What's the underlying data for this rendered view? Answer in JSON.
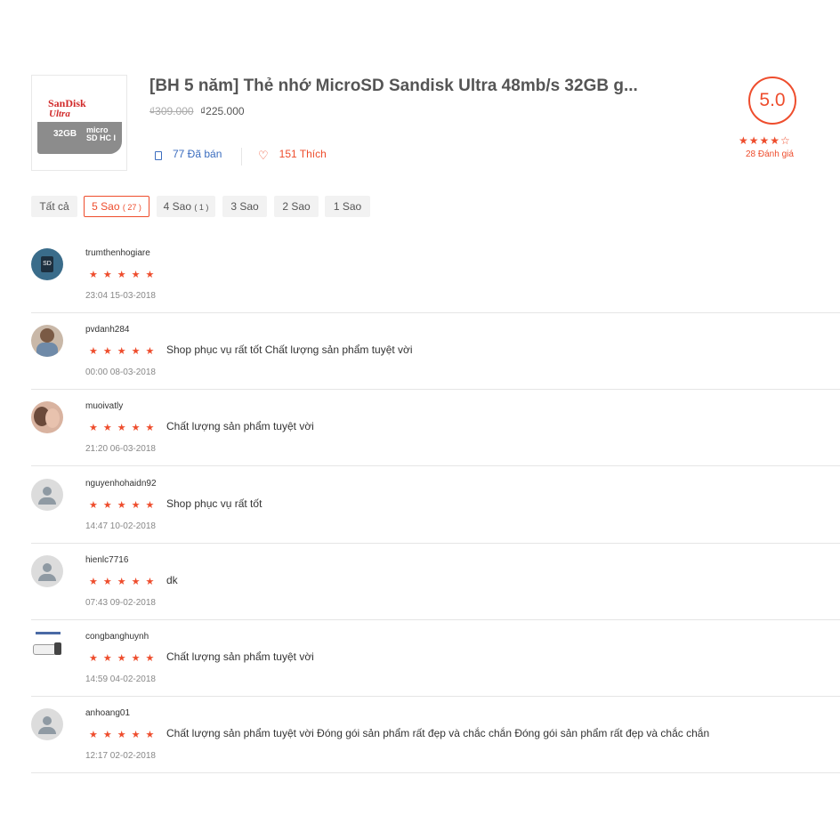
{
  "product": {
    "title": "[BH 5 năm] Thẻ nhớ MicroSD Sandisk Ultra 48mb/s 32GB g...",
    "old_price": "₫309.000",
    "new_price": "₫225.000",
    "sold": "77 Đã bán",
    "likes": "151 Thích",
    "image": {
      "brand": "SanDisk",
      "line": "Ultra",
      "capacity": "32GB",
      "logo_top": "micro",
      "logo_bottom": "SD HC I"
    }
  },
  "rating": {
    "score": "5.0",
    "stars": "★★★★☆",
    "count_label": "28 Đánh giá"
  },
  "filters": [
    {
      "label": "Tất cả",
      "count": ""
    },
    {
      "label": "5 Sao",
      "count": "( 27 )"
    },
    {
      "label": "4 Sao",
      "count": "( 1 )"
    },
    {
      "label": "3 Sao",
      "count": ""
    },
    {
      "label": "2 Sao",
      "count": ""
    },
    {
      "label": "1 Sao",
      "count": ""
    }
  ],
  "review_stars": "★★★★★",
  "reviews": [
    {
      "user": "trumthenhogiare",
      "comment": "",
      "time": "23:04 15-03-2018",
      "avatar": "sd-card-avatar",
      "chip": "SD"
    },
    {
      "user": "pvdanh284",
      "comment": "Shop phục vụ rất tốt Chất lượng sản phẩm tuyệt vời",
      "time": "00:00 08-03-2018",
      "avatar": "photo-avatar"
    },
    {
      "user": "muoivatly",
      "comment": "Chất lượng sản phẩm tuyệt vời",
      "time": "21:20 06-03-2018",
      "avatar": "photo-avatar"
    },
    {
      "user": "nguyenhohaidn92",
      "comment": "Shop phục vụ rất tốt",
      "time": "14:47 10-02-2018",
      "avatar": "default-user-avatar"
    },
    {
      "user": "hienlc7716",
      "comment": "dk",
      "time": "07:43 09-02-2018",
      "avatar": "default-user-avatar"
    },
    {
      "user": "congbanghuynh",
      "comment": "Chất lượng sản phẩm tuyệt vời",
      "time": "14:59 04-02-2018",
      "avatar": "camera-avatar"
    },
    {
      "user": "anhoang01",
      "comment": "Chất lượng sản phẩm tuyệt vời Đóng gói sản phẩm rất đẹp và chắc chắn Đóng gói sản phẩm rất đẹp và chắc chắn",
      "time": "12:17 02-02-2018",
      "avatar": "default-user-avatar"
    }
  ],
  "colors": {
    "accent": "#ee4d2d",
    "link": "#3b6dbf"
  }
}
